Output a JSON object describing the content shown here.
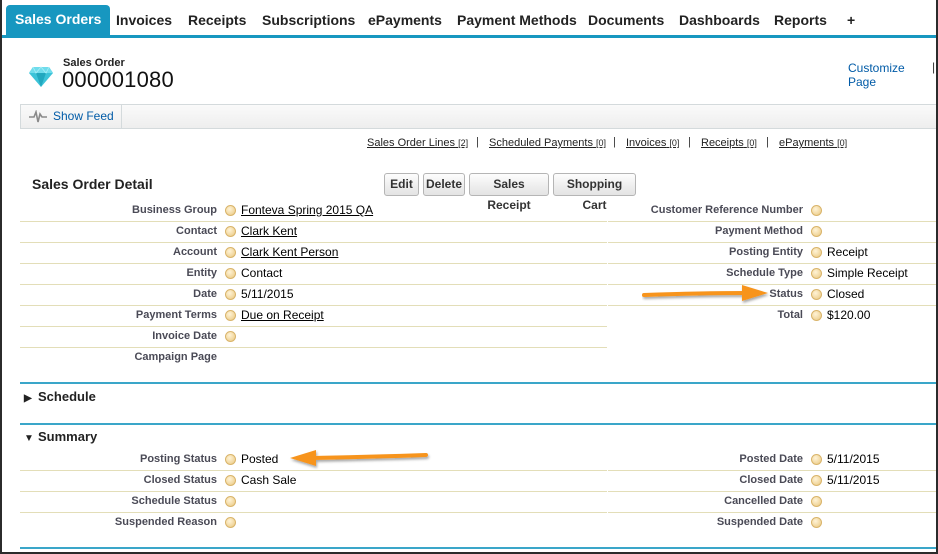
{
  "tabs": [
    {
      "label": "Sales Orders",
      "active": true
    },
    {
      "label": "Invoices"
    },
    {
      "label": "Receipts"
    },
    {
      "label": "Subscriptions"
    },
    {
      "label": "ePayments"
    },
    {
      "label": "Payment Methods"
    },
    {
      "label": "Documents"
    },
    {
      "label": "Dashboards"
    },
    {
      "label": "Reports"
    },
    {
      "label": "+"
    }
  ],
  "header": {
    "record_type": "Sales Order",
    "record_name": "000001080",
    "customize_link": "Customize Page",
    "customize_sep": "|",
    "icon": "gem-icon"
  },
  "feed": {
    "show_feed_label": "Show Feed",
    "icon": "feed-pulse-icon"
  },
  "related_links": [
    {
      "label": "Sales Order Lines",
      "count": "[2]"
    },
    {
      "label": "Scheduled Payments",
      "count": "[0]"
    },
    {
      "label": "Invoices",
      "count": "[0]"
    },
    {
      "label": "Receipts",
      "count": "[0]"
    },
    {
      "label": "ePayments",
      "count": "[0]"
    }
  ],
  "related_sep": "|",
  "detail": {
    "title": "Sales Order Detail",
    "buttons": [
      "Edit",
      "Delete",
      "Sales Receipt",
      "Shopping Cart"
    ],
    "left_fields": [
      {
        "label": "Business Group",
        "value": "Fonteva Spring 2015 QA",
        "link": true
      },
      {
        "label": "Contact",
        "value": "Clark Kent",
        "link": true
      },
      {
        "label": "Account",
        "value": "Clark Kent Person",
        "link": true
      },
      {
        "label": "Entity",
        "value": "Contact",
        "link": false
      },
      {
        "label": "Date",
        "value": "5/11/2015",
        "link": false
      },
      {
        "label": "Payment Terms",
        "value": "Due on Receipt",
        "link": true
      },
      {
        "label": "Invoice Date",
        "value": "",
        "link": false
      },
      {
        "label": "Campaign Page",
        "value": "",
        "link": false
      }
    ],
    "right_fields": [
      {
        "label": "Customer Reference Number",
        "value": ""
      },
      {
        "label": "Payment Method",
        "value": ""
      },
      {
        "label": "Posting Entity",
        "value": "Receipt"
      },
      {
        "label": "Schedule Type",
        "value": "Simple Receipt"
      },
      {
        "label": "Status",
        "value": "Closed"
      },
      {
        "label": "Total",
        "value": "$120.00"
      }
    ]
  },
  "schedule": {
    "title": "Schedule",
    "expanded": false
  },
  "summary": {
    "title": "Summary",
    "expanded": true,
    "left_fields": [
      {
        "label": "Posting Status",
        "value": "Posted"
      },
      {
        "label": "Closed Status",
        "value": "Cash Sale"
      },
      {
        "label": "Schedule Status",
        "value": ""
      },
      {
        "label": "Suspended Reason",
        "value": ""
      }
    ],
    "right_fields": [
      {
        "label": "Posted Date",
        "value": "5/11/2015"
      },
      {
        "label": "Closed Date",
        "value": "5/11/2015"
      },
      {
        "label": "Cancelled Date",
        "value": ""
      },
      {
        "label": "Suspended Date",
        "value": ""
      }
    ]
  },
  "colors": {
    "accent": "#1797c0",
    "link": "#015ba7",
    "annotation_arrow": "#f7941d"
  }
}
